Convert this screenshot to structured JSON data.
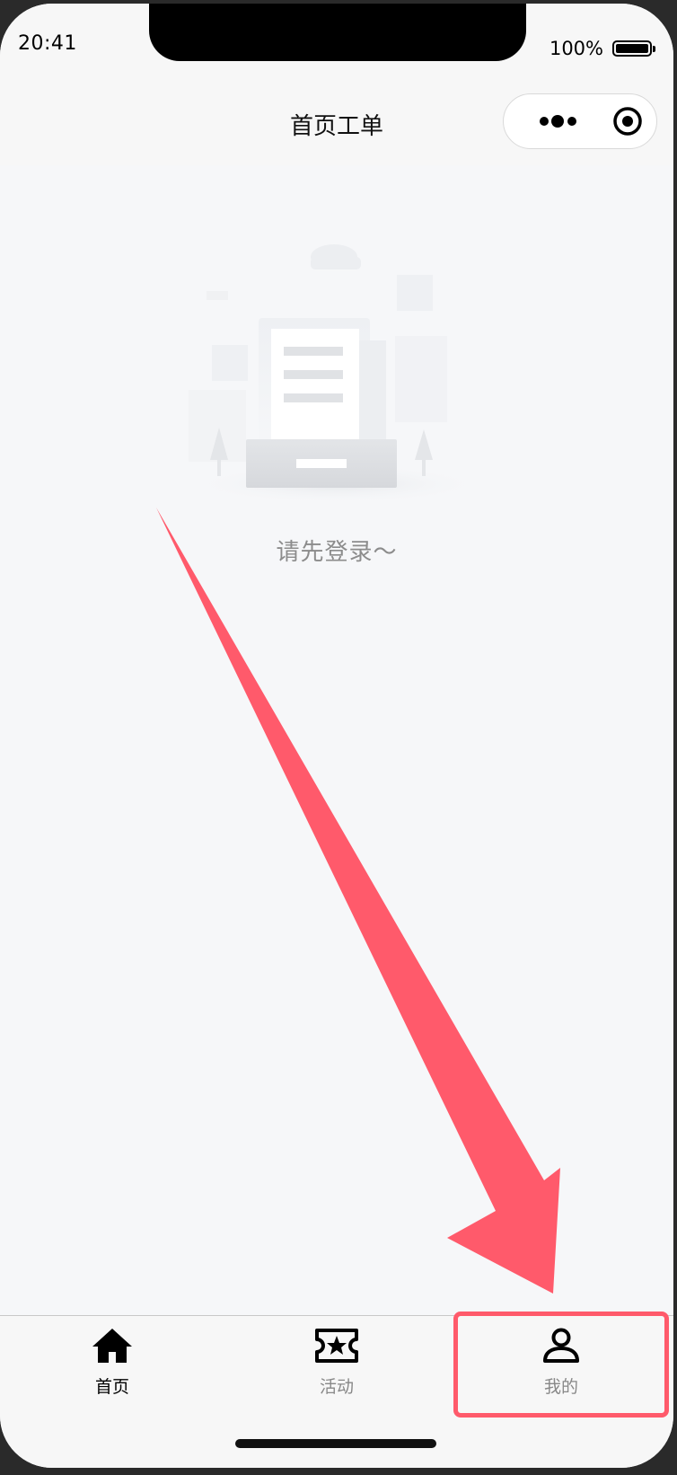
{
  "status_bar": {
    "time": "20:41",
    "battery_percent": "100%"
  },
  "nav": {
    "title": "首页工单",
    "capsule_more_icon": "more-dots-icon",
    "capsule_close_icon": "target-close-icon"
  },
  "empty_state": {
    "illustration_icon": "empty-document-illustration",
    "message": "请先登录～"
  },
  "annotation": {
    "arrow_color": "#ff5a6b",
    "highlight_target": "tab-mine"
  },
  "tab_bar": {
    "items": [
      {
        "label": "首页",
        "icon": "home-icon",
        "active": true
      },
      {
        "label": "活动",
        "icon": "ticket-star-icon",
        "active": false
      },
      {
        "label": "我的",
        "icon": "user-icon",
        "active": false
      }
    ]
  },
  "colors": {
    "background": "#f6f7f9",
    "accent_annotation": "#ff5a6b",
    "text_primary": "#000000",
    "text_muted": "#8c8c8c"
  }
}
